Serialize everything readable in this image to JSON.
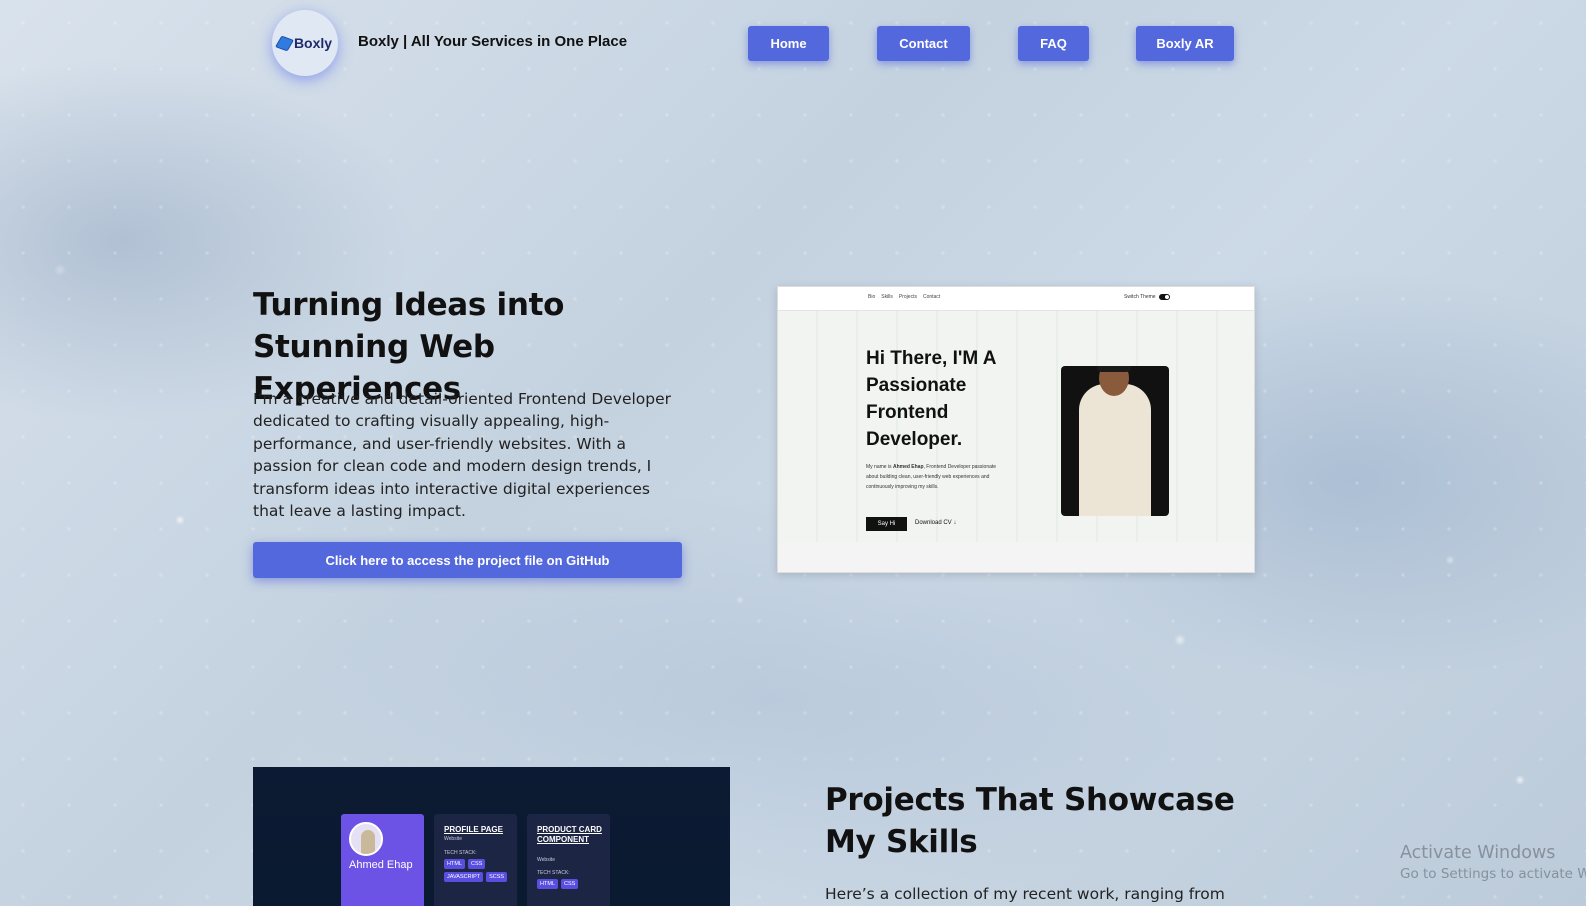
{
  "header": {
    "logo_text": "Boxly",
    "site_title": "Boxly | All Your Services in One Place",
    "nav": [
      {
        "label": "Home"
      },
      {
        "label": "Contact"
      },
      {
        "label": "FAQ"
      },
      {
        "label": "Boxly AR"
      }
    ]
  },
  "hero": {
    "title": "Turning Ideas into Stunning Web Experiences",
    "description": "I’m a creative and detail-oriented Frontend Developer dedicated to crafting visually appealing, high-performance, and user-friendly websites. With a passion for clean code and modern design trends, I transform ideas into interactive digital experiences that leave a lasting impact.",
    "github_button": "Click here to access the project file on GitHub"
  },
  "portfolio_preview": {
    "nav_links": [
      "Bio",
      "Skills",
      "Projects",
      "Contact"
    ],
    "switch_label": "Switch Theme",
    "heading": "Hi There, I'M A Passionate Frontend Developer.",
    "text_prefix": "My name is ",
    "text_name": "Ahmed Ehap",
    "text_suffix": ", Frontend Developer passionate about building clean, user-friendly web experiences and continuously improving my skills.",
    "say_hi": "Say Hi",
    "download_cv": "Download CV"
  },
  "projects": {
    "title": "Projects That Showcase My Skills",
    "description": "Here’s a collection of my recent work, ranging from",
    "cards": [
      {
        "name": "Ahmed Ehap"
      },
      {
        "title": "PROFILE PAGE",
        "subtitle": "Website",
        "stack_label": "TECH STACK:",
        "tags": [
          "HTML",
          "CSS",
          "JAVASCRIPT",
          "SCSS"
        ]
      },
      {
        "title": "PRODUCT CARD COMPONENT",
        "subtitle": "Website",
        "stack_label": "TECH STACK:",
        "tags": [
          "HTML",
          "CSS"
        ]
      }
    ]
  },
  "watermark": {
    "line1": "Activate Windows",
    "line2": "Go to Settings to activate Windows."
  }
}
